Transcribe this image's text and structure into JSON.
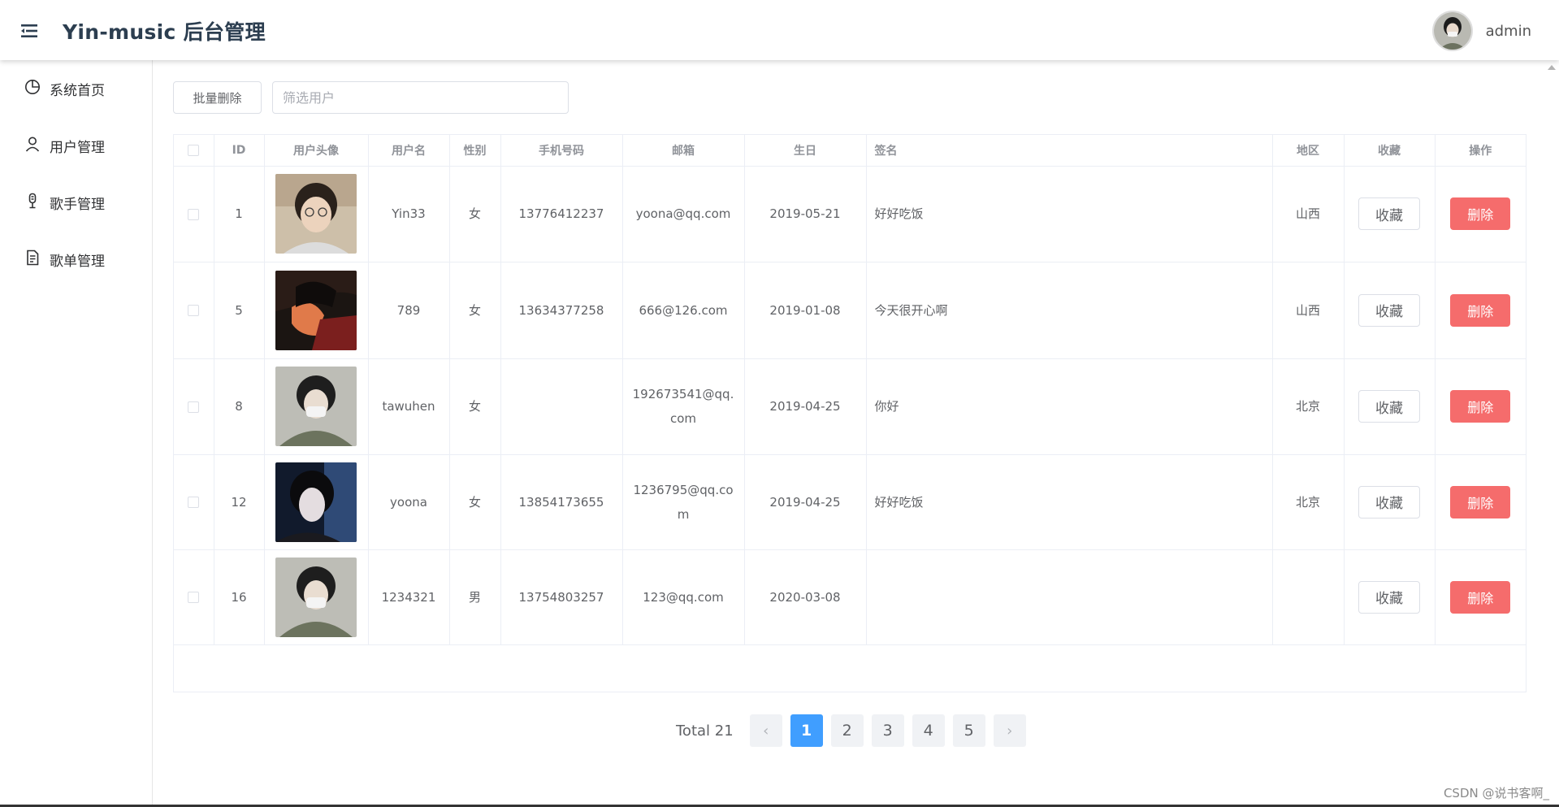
{
  "header": {
    "title": "Yin-music 后台管理",
    "user_name": "admin"
  },
  "sidebar": {
    "items": [
      {
        "label": "系统首页",
        "icon": "pie-chart-icon"
      },
      {
        "label": "用户管理",
        "icon": "user-icon"
      },
      {
        "label": "歌手管理",
        "icon": "microphone-icon"
      },
      {
        "label": "歌单管理",
        "icon": "document-icon"
      }
    ]
  },
  "toolbar": {
    "batch_delete_label": "批量删除",
    "filter_placeholder": "筛选用户",
    "filter_value": ""
  },
  "table": {
    "headers": [
      "ID",
      "用户头像",
      "用户名",
      "性别",
      "手机号码",
      "邮箱",
      "生日",
      "签名",
      "地区",
      "收藏",
      "操作"
    ],
    "rows": [
      {
        "id": "1",
        "username": "Yin33",
        "gender": "女",
        "phone": "13776412237",
        "email": "yoona@qq.com",
        "birthday": "2019-05-21",
        "signature": "好好吃饭",
        "region": "山西",
        "fav_label": "收藏",
        "del_label": "删除"
      },
      {
        "id": "5",
        "username": "789",
        "gender": "女",
        "phone": "13634377258",
        "email": "666@126.com",
        "birthday": "2019-01-08",
        "signature": "今天很开心啊",
        "region": "山西",
        "fav_label": "收藏",
        "del_label": "删除"
      },
      {
        "id": "8",
        "username": "tawuhen",
        "gender": "女",
        "phone": "",
        "email": "192673541@qq.com",
        "birthday": "2019-04-25",
        "signature": "你好",
        "region": "北京",
        "fav_label": "收藏",
        "del_label": "删除"
      },
      {
        "id": "12",
        "username": "yoona",
        "gender": "女",
        "phone": "13854173655",
        "email": "1236795@qq.com",
        "birthday": "2019-04-25",
        "signature": "好好吃饭",
        "region": "北京",
        "fav_label": "收藏",
        "del_label": "删除"
      },
      {
        "id": "16",
        "username": "1234321",
        "gender": "男",
        "phone": "13754803257",
        "email": "123@qq.com",
        "birthday": "2020-03-08",
        "signature": "",
        "region": "",
        "fav_label": "收藏",
        "del_label": "删除"
      }
    ]
  },
  "pagination": {
    "total_label": "Total 21",
    "pages": [
      "1",
      "2",
      "3",
      "4",
      "5"
    ],
    "current": "1",
    "prev_icon": "chevron-left-icon",
    "next_icon": "chevron-right-icon"
  },
  "watermark": "CSDN @说书客啊_",
  "colors": {
    "accent": "#409eff",
    "danger": "#f56c6c",
    "title": "#2c3e50"
  }
}
